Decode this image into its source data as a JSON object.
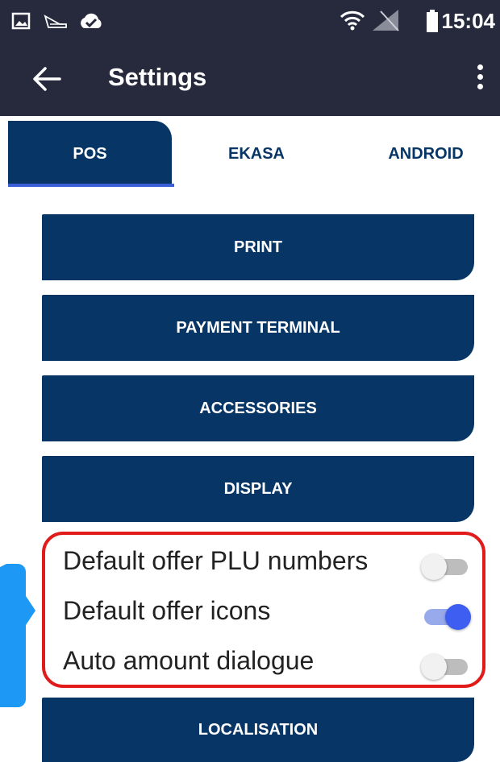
{
  "status_bar": {
    "time": "15:04",
    "icons": [
      "image-icon",
      "satellite-icon",
      "cloud-check-icon",
      "wifi-icon",
      "no-signal-icon",
      "battery-icon"
    ]
  },
  "app_bar": {
    "title": "Settings",
    "back_icon": "arrow-left-icon",
    "menu_icon": "more-vert-icon"
  },
  "tabs": [
    {
      "label": "POS",
      "active": true
    },
    {
      "label": "EKASA",
      "active": false
    },
    {
      "label": "ANDROID",
      "active": false
    }
  ],
  "menu_buttons": {
    "print": "PRINT",
    "payment_terminal": "PAYMENT TERMINAL",
    "accessories": "ACCESSORIES",
    "display": "DISPLAY",
    "localisation": "LOCALISATION"
  },
  "toggles": [
    {
      "label": "Default offer PLU numbers",
      "on": false
    },
    {
      "label": "Default offer icons",
      "on": true
    },
    {
      "label": "Auto amount dialogue",
      "on": false
    }
  ],
  "colors": {
    "app_bar": "#272a3d",
    "primary": "#073565",
    "highlight": "#e11a1a",
    "callout": "#1e98f5",
    "switch_on": "#3d5ef0"
  }
}
